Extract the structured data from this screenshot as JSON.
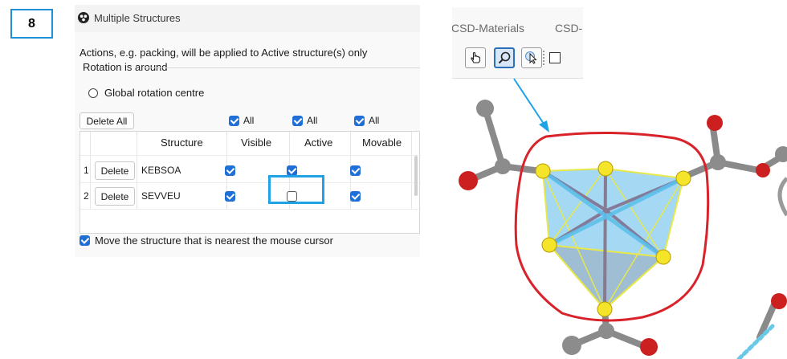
{
  "step": {
    "number": "8"
  },
  "panel": {
    "title": "Multiple Structures",
    "notice": "Actions, e.g. packing, will be applied to Active structure(s) only",
    "rotation_group_label": "Rotation is around",
    "rotation_option": "Global rotation centre",
    "delete_all_label": "Delete All",
    "all_label": "All",
    "columns": [
      "Structure",
      "Visible",
      "Active",
      "Movable"
    ],
    "rows": [
      {
        "index": "1",
        "delete_label": "Delete",
        "structure": "KEBSOA",
        "visible": true,
        "active": true,
        "movable": true
      },
      {
        "index": "2",
        "delete_label": "Delete",
        "structure": "SEVVEU",
        "visible": true,
        "active": false,
        "movable": true
      }
    ],
    "move_nearest_label": "Move the structure that is nearest the mouse cursor"
  },
  "toolbar": {
    "tabs": [
      "CSD-Materials",
      "CSD-"
    ],
    "buttons": [
      "hand-pointer-icon",
      "zoom-lasso-icon",
      "pick-cursor-icon"
    ]
  },
  "colors": {
    "accent": "#1fa3e6",
    "checkbox": "#1f6fd6",
    "annotation_red": "#d8232a",
    "polyhedron": "#7fc8ee"
  }
}
